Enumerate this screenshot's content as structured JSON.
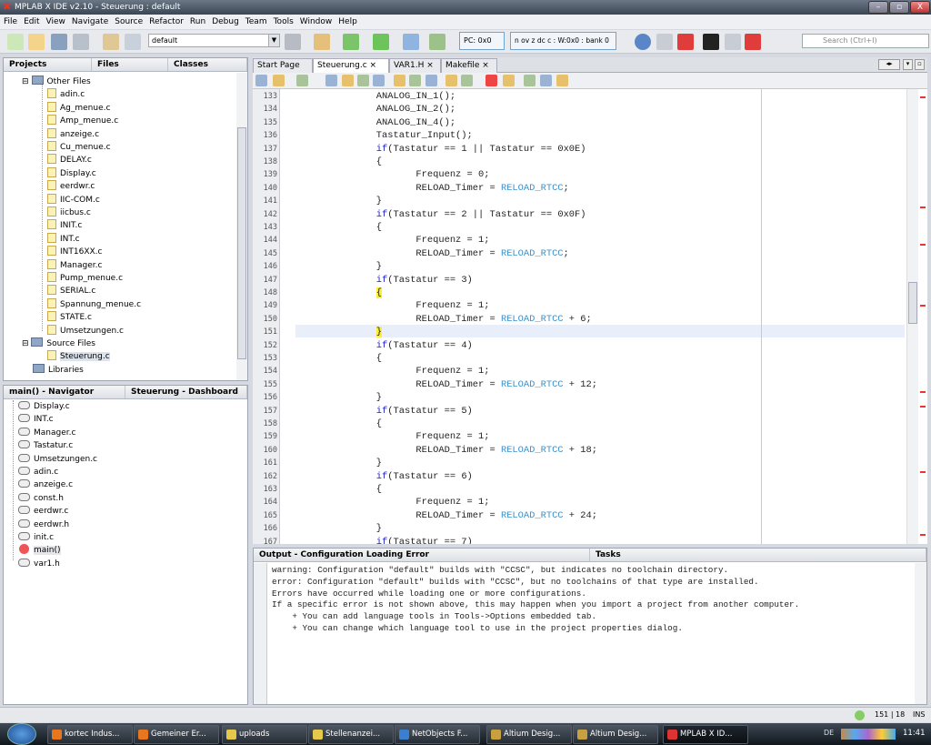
{
  "window": {
    "title": "MPLAB X IDE v2.10 - Steuerung : default",
    "minimize": "–",
    "maximize": "▫",
    "close": "X"
  },
  "menu": [
    "File",
    "Edit",
    "View",
    "Navigate",
    "Source",
    "Refactor",
    "Run",
    "Debug",
    "Team",
    "Tools",
    "Window",
    "Help"
  ],
  "toolbar": {
    "config": "default",
    "pc": "PC: 0x0",
    "status": "n ov z dc c  : W:0x0 : bank 0",
    "search_placeholder": "Search (Ctrl+I)"
  },
  "projects": {
    "tabs": [
      "Projects",
      "Files",
      "Classes"
    ],
    "other_files_label": "Other Files",
    "other_files": [
      "adin.c",
      "Ag_menue.c",
      "Amp_menue.c",
      "anzeige.c",
      "Cu_menue.c",
      "DELAY.c",
      "Display.c",
      "eerdwr.c",
      "IIC-COM.c",
      "iicbus.c",
      "INIT.c",
      "INT.c",
      "INT16XX.c",
      "Manager.c",
      "Pump_menue.c",
      "SERIAL.c",
      "Spannung_menue.c",
      "STATE.c",
      "Umsetzungen.c"
    ],
    "source_files_label": "Source Files",
    "source_files": [
      "Steuerung.c"
    ],
    "libraries_label": "Libraries"
  },
  "navigator": {
    "tabs": [
      "main() - Navigator",
      "Steuerung - Dashboard"
    ],
    "items": [
      "Display.c",
      "INT.c",
      "Manager.c",
      "Tastatur.c",
      "Umsetzungen.c",
      "adin.c",
      "anzeige.c",
      "const.h",
      "eerdwr.c",
      "eerdwr.h",
      "init.c",
      "main()",
      "var1.h"
    ]
  },
  "editor": {
    "tabs": [
      "Start Page",
      "Steuerung.c",
      "VAR1.H",
      "Makefile"
    ],
    "active_tab": 1,
    "lines": [
      {
        "n": "133",
        "t": "                ANALOG_IN_1();"
      },
      {
        "n": "134",
        "t": "                ANALOG_IN_2();"
      },
      {
        "n": "135",
        "t": "                ANALOG_IN_4();"
      },
      {
        "n": "136",
        "t": "                Tastatur_Input();"
      },
      {
        "n": "137",
        "t": "                if(Tastatur == 1 || Tastatur == 0x0E)"
      },
      {
        "n": "138",
        "t": "                {"
      },
      {
        "n": "139",
        "t": "                       Frequenz = 0;"
      },
      {
        "n": "140",
        "t": "                       RELOAD_Timer = RELOAD_RTCC;"
      },
      {
        "n": "141",
        "t": "                }"
      },
      {
        "n": "142",
        "t": "                if(Tastatur == 2 || Tastatur == 0x0F)"
      },
      {
        "n": "143",
        "t": "                {"
      },
      {
        "n": "144",
        "t": "                       Frequenz = 1;"
      },
      {
        "n": "145",
        "t": "                       RELOAD_Timer = RELOAD_RTCC;"
      },
      {
        "n": "146",
        "t": "                }"
      },
      {
        "n": "147",
        "t": "                if(Tastatur == 3)"
      },
      {
        "n": "148",
        "t": "                {"
      },
      {
        "n": "149",
        "t": "                       Frequenz = 1;"
      },
      {
        "n": "150",
        "t": "                       RELOAD_Timer = RELOAD_RTCC + 6;"
      },
      {
        "n": "151",
        "t": "                }"
      },
      {
        "n": "152",
        "t": "                if(Tastatur == 4)"
      },
      {
        "n": "153",
        "t": "                {"
      },
      {
        "n": "154",
        "t": "                       Frequenz = 1;"
      },
      {
        "n": "155",
        "t": "                       RELOAD_Timer = RELOAD_RTCC + 12;"
      },
      {
        "n": "156",
        "t": "                }"
      },
      {
        "n": "157",
        "t": "                if(Tastatur == 5)"
      },
      {
        "n": "158",
        "t": "                {"
      },
      {
        "n": "159",
        "t": "                       Frequenz = 1;"
      },
      {
        "n": "160",
        "t": "                       RELOAD_Timer = RELOAD_RTCC + 18;"
      },
      {
        "n": "161",
        "t": "                }"
      },
      {
        "n": "162",
        "t": "                if(Tastatur == 6)"
      },
      {
        "n": "163",
        "t": "                {"
      },
      {
        "n": "164",
        "t": "                       Frequenz = 1;"
      },
      {
        "n": "165",
        "t": "                       RELOAD_Timer = RELOAD_RTCC + 24;"
      },
      {
        "n": "166",
        "t": "                }"
      },
      {
        "n": "167",
        "t": "                if(Tastatur == 7)"
      }
    ]
  },
  "output": {
    "tabs": [
      "Output - Configuration Loading Error",
      "Tasks"
    ],
    "text": "warning: Configuration \"default\" builds with \"CCSC\", but indicates no toolchain directory.\nerror: Configuration \"default\" builds with \"CCSC\", but no toolchains of that type are installed.\nErrors have occurred while loading one or more configurations.\nIf a specific error is not shown above, this may happen when you import a project from another computer.\n    + You can add language tools in Tools->Options embedded tab.\n    + You can change which language tool to use in the project properties dialog."
  },
  "status": {
    "position": "151 | 18",
    "mode": "INS"
  },
  "taskbar": {
    "items": [
      "kortec Indus...",
      "Gemeiner Er...",
      "uploads",
      "Stellenanzei...",
      "NetObjects F...",
      "Altium Desig...",
      "Altium Desig...",
      "MPLAB X ID..."
    ],
    "lang": "DE",
    "clock": "11:41"
  },
  "colors": {
    "keyword": "#2323d0",
    "macro": "#3b8fc8",
    "brace_match": "#ffee33",
    "error_mark": "#e33333"
  }
}
